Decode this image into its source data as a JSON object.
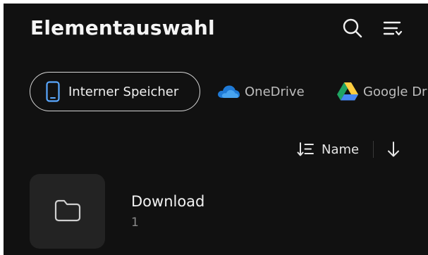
{
  "header": {
    "title": "Elementauswahl",
    "icons": [
      "search-icon",
      "sort-list-icon"
    ]
  },
  "storage_chips": [
    {
      "label": "Interner Speicher",
      "icon": "phone-icon",
      "selected": true
    },
    {
      "label": "OneDrive",
      "icon": "onedrive-icon",
      "selected": false
    },
    {
      "label": "Google Drive",
      "icon": "google-drive-icon",
      "selected": false
    }
  ],
  "sort": {
    "label": "Name",
    "direction": "descending",
    "type_icon": "sort-type-icon",
    "direction_icon": "arrow-down-icon"
  },
  "items": [
    {
      "name": "Download",
      "count": "1",
      "icon": "folder-icon"
    }
  ],
  "colors": {
    "background": "#111111",
    "chip_border": "#d6d6d6",
    "phone_icon_accent": "#5aa8ff",
    "thumbnail_bg": "#232323",
    "secondary_text": "#8a8a8a",
    "onedrive_blue": "#1f7ad6",
    "gdrive_green": "#1fa463",
    "gdrive_yellow": "#ffcd40",
    "gdrive_blue": "#4688f4"
  }
}
